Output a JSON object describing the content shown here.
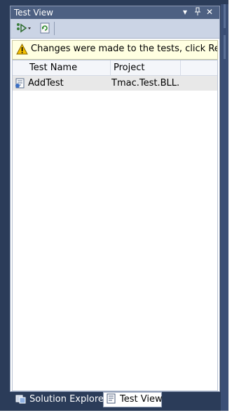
{
  "panel": {
    "title": "Test View",
    "title_buttons": {
      "dropdown": "▾",
      "pin": "ᵖ",
      "close": "✕"
    }
  },
  "toolbar": {
    "run_icon": "run-tests-icon",
    "refresh_icon": "refresh-icon"
  },
  "warning": {
    "icon": "warning-icon",
    "message": "Changes were made to the tests, click Refres"
  },
  "grid": {
    "columns": [
      "Test Name",
      "Project"
    ],
    "rows": [
      {
        "icon": "test-file-icon",
        "name": "AddTest",
        "project": "Tmac.Test.BLL.Te"
      }
    ]
  },
  "tabs": [
    {
      "label": "Solution Explorer",
      "icon": "solution-explorer-icon",
      "active": false
    },
    {
      "label": "Test View",
      "icon": "test-view-icon",
      "active": true
    }
  ],
  "colors": {
    "frame": "#2b3c59",
    "titlebar": "#4d6082",
    "toolbar": "#cbd4e5",
    "warning_bg": "#ffffe1",
    "selected_row": "#e8e8e8"
  }
}
